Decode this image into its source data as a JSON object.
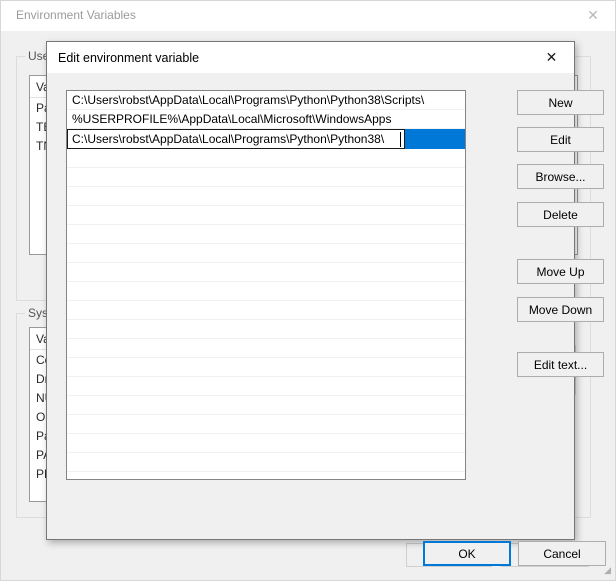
{
  "background_window": {
    "title": "Environment Variables",
    "close_icon": "close-icon",
    "user_group": {
      "label": "User",
      "header": {
        "variable": "Va",
        "value": ""
      },
      "rows": [
        {
          "variable": "Pa"
        },
        {
          "variable": "TE"
        },
        {
          "variable": "TN"
        }
      ]
    },
    "system_group": {
      "label": "Syste",
      "header": {
        "variable": "Va",
        "value": ""
      },
      "rows": [
        {
          "variable": "Co"
        },
        {
          "variable": "Dr"
        },
        {
          "variable": "NU"
        },
        {
          "variable": "OS"
        },
        {
          "variable": "Pa"
        },
        {
          "variable": "PA"
        },
        {
          "variable": "PR"
        }
      ]
    },
    "scrollbar": {
      "up_arrow": "chevron-up-icon",
      "down_arrow": "chevron-down-icon"
    },
    "resize_grip": "resize-grip-icon",
    "footer": {
      "ok_label": "OK",
      "cancel_label": "Cancel"
    }
  },
  "dialog": {
    "title": "Edit environment variable",
    "close_icon": "close-icon",
    "list": {
      "rows": [
        {
          "text": "C:\\Users\\robst\\AppData\\Local\\Programs\\Python\\Python38\\Scripts\\",
          "state": "normal"
        },
        {
          "text": "%USERPROFILE%\\AppData\\Local\\Microsoft\\WindowsApps",
          "state": "normal"
        },
        {
          "text": "C:\\Users\\robst\\AppData\\Local\\Programs\\Python\\Python38\\",
          "state": "editing"
        }
      ],
      "empty_row_count": 18
    },
    "side_buttons": [
      {
        "label": "New",
        "name": "new-button"
      },
      {
        "label": "Edit",
        "name": "edit-button"
      },
      {
        "label": "Browse...",
        "name": "browse-button"
      },
      {
        "label": "Delete",
        "name": "delete-button"
      },
      {
        "label": "Move Up",
        "name": "move-up-button"
      },
      {
        "label": "Move Down",
        "name": "move-down-button"
      },
      {
        "label": "Edit text...",
        "name": "edit-text-button"
      }
    ],
    "footer": {
      "ok_label": "OK",
      "cancel_label": "Cancel"
    }
  },
  "colors": {
    "selection_blue": "#0078D7",
    "dialog_face": "#F0F0F0",
    "window_face": "#F0F0F0",
    "focus_border": "#0078D7"
  }
}
